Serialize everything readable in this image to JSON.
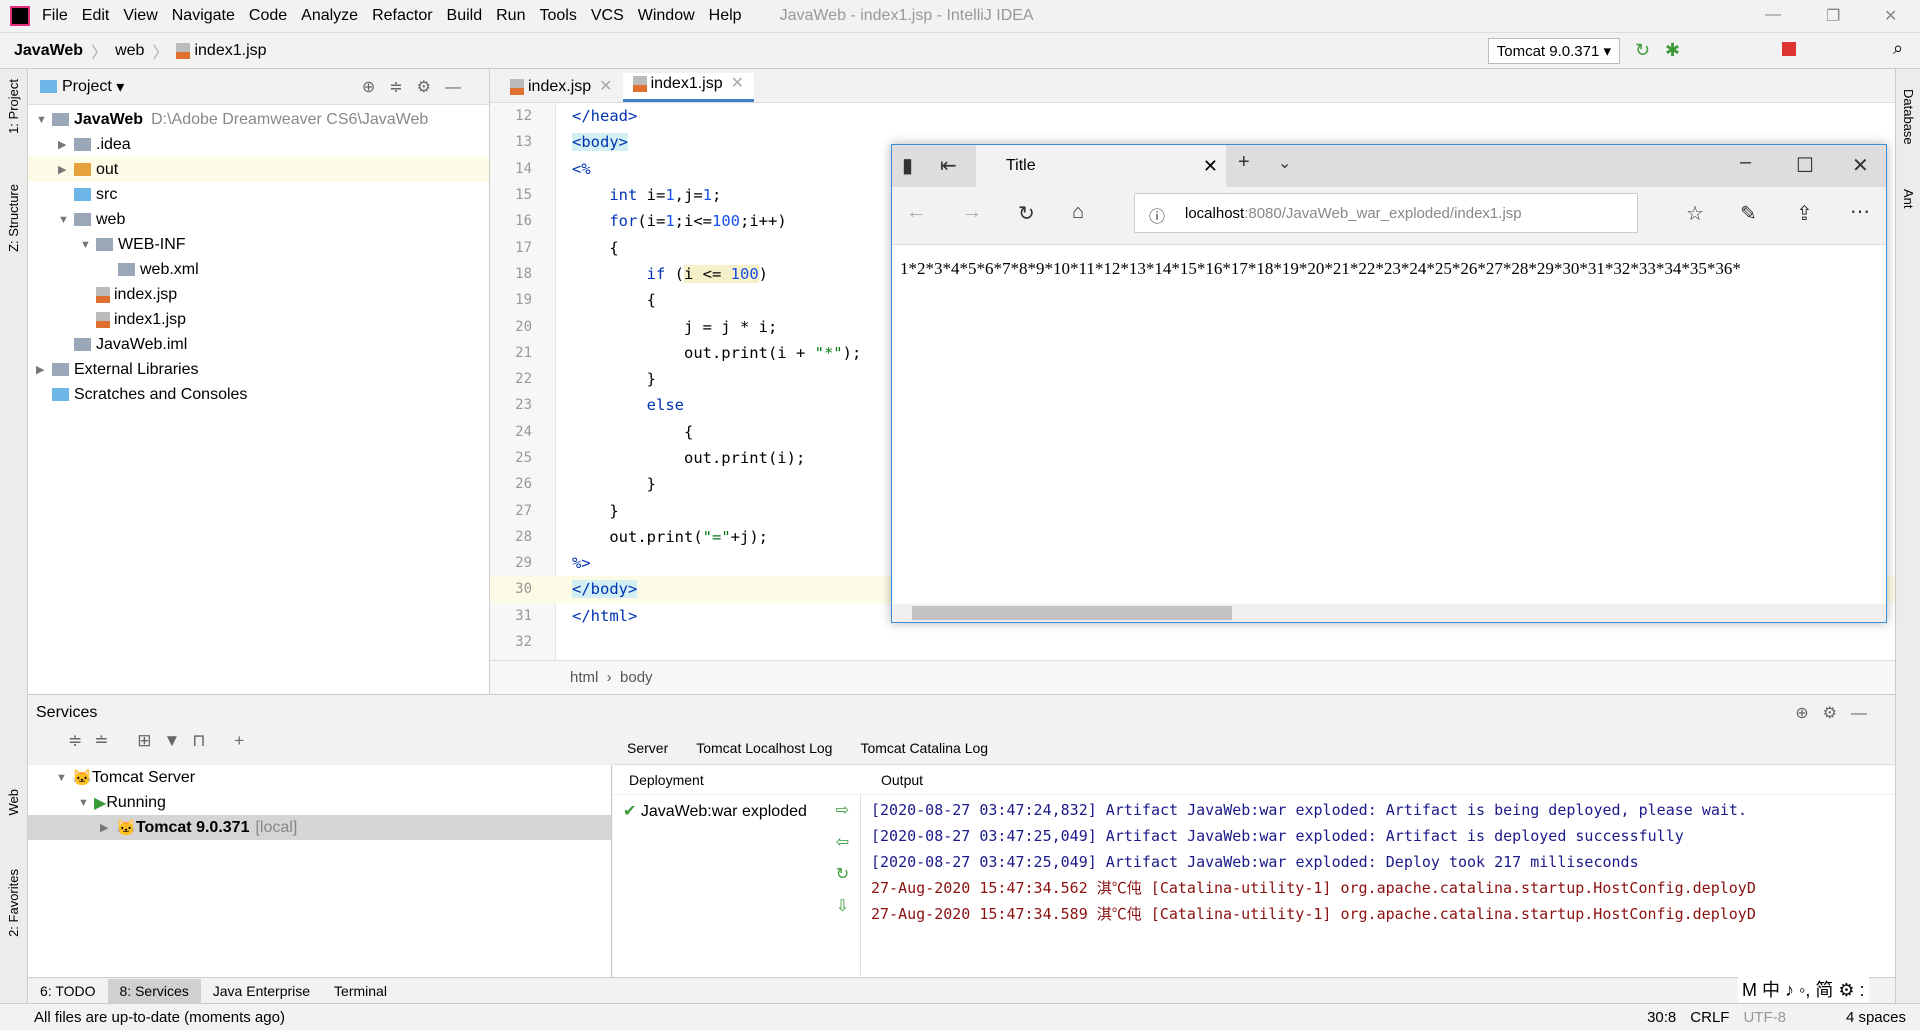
{
  "menu": {
    "items": [
      "File",
      "Edit",
      "View",
      "Navigate",
      "Code",
      "Analyze",
      "Refactor",
      "Build",
      "Run",
      "Tools",
      "VCS",
      "Window",
      "Help"
    ],
    "window_title": "JavaWeb - index1.jsp - IntelliJ IDEA"
  },
  "breadcrumb": [
    "JavaWeb",
    "web",
    "index1.jsp"
  ],
  "run_config": "Tomcat 9.0.371",
  "left_strip": [
    "1: Project",
    "Z: Structure",
    "Web",
    "2: Favorites"
  ],
  "right_strip": [
    "Database",
    "Ant"
  ],
  "project": {
    "title": "Project",
    "tree": [
      {
        "label": "JavaWeb",
        "path": "D:\\Adobe Dreamweaver CS6\\JavaWeb",
        "depth": 0,
        "arrow": "▼",
        "icon": "module"
      },
      {
        "label": ".idea",
        "depth": 1,
        "arrow": "▶",
        "icon": "folder"
      },
      {
        "label": "out",
        "depth": 1,
        "arrow": "▶",
        "icon": "folder-orange"
      },
      {
        "label": "src",
        "depth": 1,
        "arrow": "",
        "icon": "folder-blue"
      },
      {
        "label": "web",
        "depth": 1,
        "arrow": "▼",
        "icon": "folder"
      },
      {
        "label": "WEB-INF",
        "depth": 2,
        "arrow": "▼",
        "icon": "folder"
      },
      {
        "label": "web.xml",
        "depth": 3,
        "arrow": "",
        "icon": "xml"
      },
      {
        "label": "index.jsp",
        "depth": 2,
        "arrow": "",
        "icon": "jsp"
      },
      {
        "label": "index1.jsp",
        "depth": 2,
        "arrow": "",
        "icon": "jsp"
      },
      {
        "label": "JavaWeb.iml",
        "depth": 1,
        "arrow": "",
        "icon": "iml"
      },
      {
        "label": "External Libraries",
        "depth": 0,
        "arrow": "▶",
        "icon": "library"
      },
      {
        "label": "Scratches and Consoles",
        "depth": 0,
        "arrow": "",
        "icon": "scratch"
      }
    ]
  },
  "editor": {
    "tabs": [
      {
        "label": "index.jsp",
        "active": false
      },
      {
        "label": "index1.jsp",
        "active": true
      }
    ],
    "lines": [
      {
        "n": "12",
        "html": "<span class='tag'>&lt;/head&gt;</span>"
      },
      {
        "n": "13",
        "html": "<span class='tag hl'>&lt;body&gt;</span>"
      },
      {
        "n": "14",
        "html": "<span class='tag'>&lt;%</span>"
      },
      {
        "n": "15",
        "html": "    <span class='kw'>int</span> i=<span class='num'>1</span>,j=<span class='num'>1</span>;"
      },
      {
        "n": "16",
        "html": "    <span class='kw'>for</span>(i=<span class='num'>1</span>;i&lt;=<span class='num'>100</span>;i++)"
      },
      {
        "n": "17",
        "html": "    {"
      },
      {
        "n": "18",
        "html": "        <span class='kw'>if</span> (<span style='background:#f5f0c8'>i &lt;= <span class='num'>100</span></span>)"
      },
      {
        "n": "19",
        "html": "        {"
      },
      {
        "n": "20",
        "html": "            j = j * i;"
      },
      {
        "n": "21",
        "html": "            out.print(i + <span class='str'>\"*\"</span>);"
      },
      {
        "n": "22",
        "html": "        }"
      },
      {
        "n": "23",
        "html": "        <span class='kw'>else</span>"
      },
      {
        "n": "24",
        "html": "            {"
      },
      {
        "n": "25",
        "html": "            out.print(i);"
      },
      {
        "n": "26",
        "html": "        }"
      },
      {
        "n": "27",
        "html": "    }"
      },
      {
        "n": "28",
        "html": "    out.print(<span class='str'>\"=\"</span>+j);"
      },
      {
        "n": "29",
        "html": "<span class='tag'>%&gt;</span>"
      },
      {
        "n": "30",
        "html": "<span class='tag hl'>&lt;/body&gt;</span>",
        "current": true
      },
      {
        "n": "31",
        "html": "<span class='tag'>&lt;/html&gt;</span>"
      },
      {
        "n": "32",
        "html": ""
      }
    ],
    "breadcrumb": [
      "html",
      "body"
    ]
  },
  "browser": {
    "tab_title": "Title",
    "url_host": "localhost",
    "url_rest": ":8080/JavaWeb_war_exploded/index1.jsp",
    "content": "1*2*3*4*5*6*7*8*9*10*11*12*13*14*15*16*17*18*19*20*21*22*23*24*25*26*27*28*29*30*31*32*33*34*35*36*"
  },
  "services": {
    "title": "Services",
    "tree": [
      {
        "label": "Tomcat Server",
        "depth": 0
      },
      {
        "label": "Running",
        "depth": 1
      },
      {
        "label": "Tomcat 9.0.371",
        "suffix": "[local]",
        "depth": 2
      }
    ],
    "tabs": [
      "Server",
      "Tomcat Localhost Log",
      "Tomcat Catalina Log"
    ],
    "deployment_header": "Deployment",
    "output_header": "Output",
    "deployment": "JavaWeb:war exploded",
    "output": [
      {
        "text": "[2020-08-27 03:47:24,832] Artifact JavaWeb:war exploded: Artifact is being deployed, please wait.",
        "level": "info"
      },
      {
        "text": "[2020-08-27 03:47:25,049] Artifact JavaWeb:war exploded: Artifact is deployed successfully",
        "level": "info"
      },
      {
        "text": "[2020-08-27 03:47:25,049] Artifact JavaWeb:war exploded: Deploy took 217 milliseconds",
        "level": "info"
      },
      {
        "text": "27-Aug-2020 15:47:34.562 淇℃伅 [Catalina-utility-1] org.apache.catalina.startup.HostConfig.deployD",
        "level": "error"
      },
      {
        "text": "27-Aug-2020 15:47:34.589 淇℃伅 [Catalina-utility-1] org.apache.catalina.startup.HostConfig.deployD",
        "level": "error"
      }
    ]
  },
  "bottom_tabs": [
    {
      "label": "6: TODO"
    },
    {
      "label": "8: Services",
      "active": true
    },
    {
      "label": "Java Enterprise"
    },
    {
      "label": "Terminal"
    }
  ],
  "ime": "M 中 ♪ ◦, 简 ⚙ :",
  "status": {
    "message": "All files are up-to-date (moments ago)",
    "position": "30:8",
    "line_sep": "CRLF",
    "encoding": "UTF-8",
    "indent": "4 spaces"
  }
}
